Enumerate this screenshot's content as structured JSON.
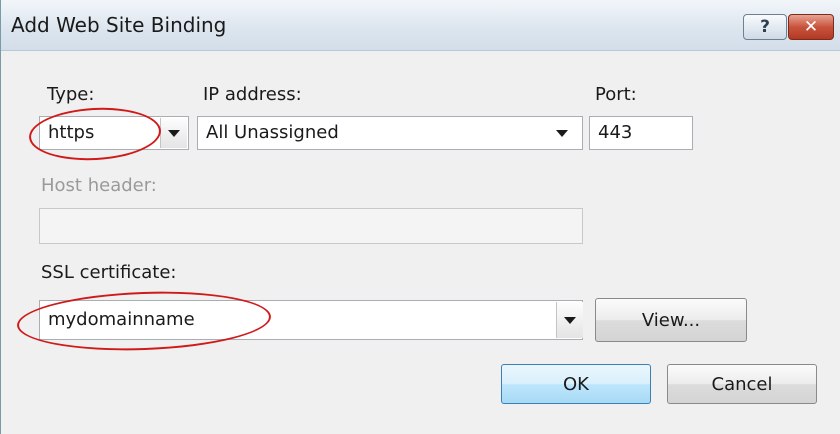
{
  "dialog": {
    "title": "Add Web Site Binding",
    "help_glyph": "?",
    "close_glyph": "✕"
  },
  "type": {
    "label": "Type:",
    "value": "https"
  },
  "ip_address": {
    "label": "IP address:",
    "value": "All Unassigned"
  },
  "port": {
    "label": "Port:",
    "value": "443"
  },
  "host_header": {
    "label": "Host header:",
    "value": ""
  },
  "ssl_certificate": {
    "label": "SSL certificate:",
    "value": "mydomainname",
    "view_button": "View..."
  },
  "buttons": {
    "ok": "OK",
    "cancel": "Cancel"
  },
  "colors": {
    "annotation_circle": "#d01a1a",
    "default_button_border": "#3c7fb1"
  }
}
